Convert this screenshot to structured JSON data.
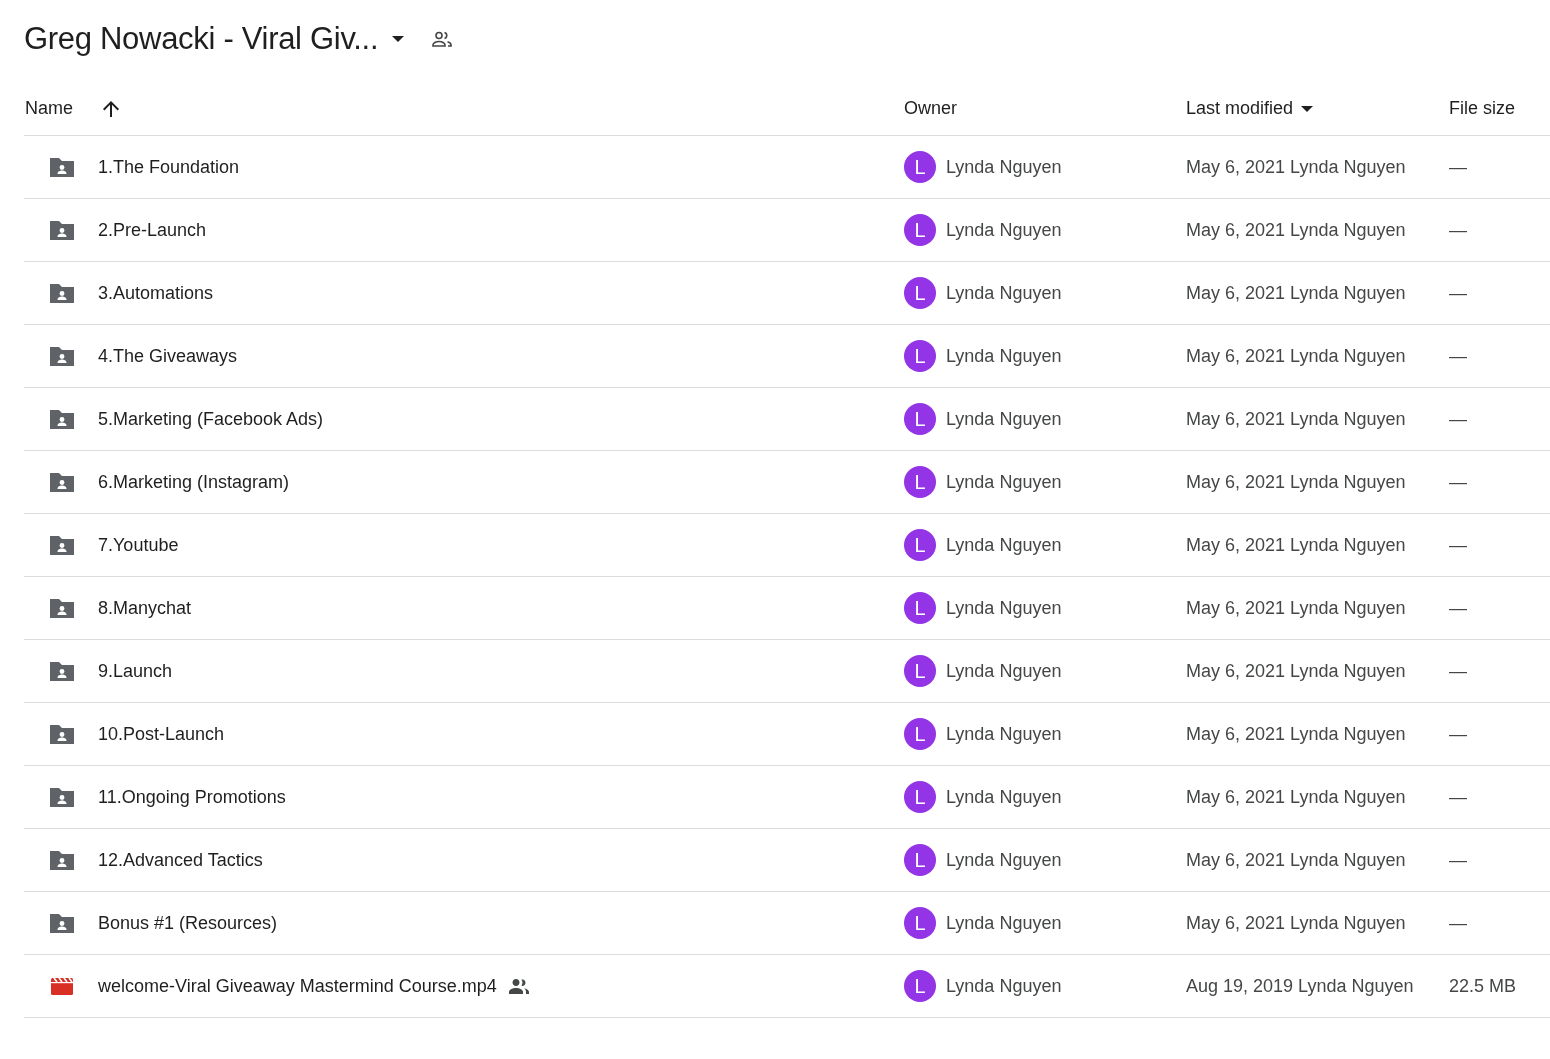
{
  "header": {
    "title": "Greg Nowacki - Viral Giv..."
  },
  "table": {
    "columns": [
      {
        "label": "Name",
        "sorted_ascending": true,
        "sorted_descending": false
      },
      {
        "label": "Owner",
        "sorted_ascending": false,
        "sorted_descending": false
      },
      {
        "label": "Last modified",
        "sorted_ascending": false,
        "sorted_descending": true
      },
      {
        "label": "File size",
        "sorted_ascending": false,
        "sorted_descending": false
      }
    ],
    "rows": [
      {
        "kind": "folder",
        "name": "1.The Foundation",
        "shared": false,
        "owner_initial": "L",
        "owner": "Lynda Nguyen",
        "modified": "May 6, 2021",
        "modified_by": "Lynda Nguyen",
        "size": "—"
      },
      {
        "kind": "folder",
        "name": "2.Pre-Launch",
        "shared": false,
        "owner_initial": "L",
        "owner": "Lynda Nguyen",
        "modified": "May 6, 2021",
        "modified_by": "Lynda Nguyen",
        "size": "—"
      },
      {
        "kind": "folder",
        "name": "3.Automations",
        "shared": false,
        "owner_initial": "L",
        "owner": "Lynda Nguyen",
        "modified": "May 6, 2021",
        "modified_by": "Lynda Nguyen",
        "size": "—"
      },
      {
        "kind": "folder",
        "name": "4.The Giveaways",
        "shared": false,
        "owner_initial": "L",
        "owner": "Lynda Nguyen",
        "modified": "May 6, 2021",
        "modified_by": "Lynda Nguyen",
        "size": "—"
      },
      {
        "kind": "folder",
        "name": "5.Marketing (Facebook Ads)",
        "shared": false,
        "owner_initial": "L",
        "owner": "Lynda Nguyen",
        "modified": "May 6, 2021",
        "modified_by": "Lynda Nguyen",
        "size": "—"
      },
      {
        "kind": "folder",
        "name": "6.Marketing (Instagram)",
        "shared": false,
        "owner_initial": "L",
        "owner": "Lynda Nguyen",
        "modified": "May 6, 2021",
        "modified_by": "Lynda Nguyen",
        "size": "—"
      },
      {
        "kind": "folder",
        "name": "7.Youtube",
        "shared": false,
        "owner_initial": "L",
        "owner": "Lynda Nguyen",
        "modified": "May 6, 2021",
        "modified_by": "Lynda Nguyen",
        "size": "—"
      },
      {
        "kind": "folder",
        "name": "8.Manychat",
        "shared": false,
        "owner_initial": "L",
        "owner": "Lynda Nguyen",
        "modified": "May 6, 2021",
        "modified_by": "Lynda Nguyen",
        "size": "—"
      },
      {
        "kind": "folder",
        "name": "9.Launch",
        "shared": false,
        "owner_initial": "L",
        "owner": "Lynda Nguyen",
        "modified": "May 6, 2021",
        "modified_by": "Lynda Nguyen",
        "size": "—"
      },
      {
        "kind": "folder",
        "name": "10.Post-Launch",
        "shared": false,
        "owner_initial": "L",
        "owner": "Lynda Nguyen",
        "modified": "May 6, 2021",
        "modified_by": "Lynda Nguyen",
        "size": "—"
      },
      {
        "kind": "folder",
        "name": "11.Ongoing Promotions",
        "shared": false,
        "owner_initial": "L",
        "owner": "Lynda Nguyen",
        "modified": "May 6, 2021",
        "modified_by": "Lynda Nguyen",
        "size": "—"
      },
      {
        "kind": "folder",
        "name": "12.Advanced Tactics",
        "shared": false,
        "owner_initial": "L",
        "owner": "Lynda Nguyen",
        "modified": "May 6, 2021",
        "modified_by": "Lynda Nguyen",
        "size": "—"
      },
      {
        "kind": "folder",
        "name": "Bonus #1 (Resources)",
        "shared": false,
        "owner_initial": "L",
        "owner": "Lynda Nguyen",
        "modified": "May 6, 2021",
        "modified_by": "Lynda Nguyen",
        "size": "—"
      },
      {
        "kind": "video",
        "name": "welcome-Viral Giveaway Mastermind Course.mp4",
        "shared": true,
        "owner_initial": "L",
        "owner": "Lynda Nguyen",
        "modified": "Aug 19, 2019",
        "modified_by": "Lynda Nguyen",
        "size": "22.5 MB"
      }
    ]
  }
}
